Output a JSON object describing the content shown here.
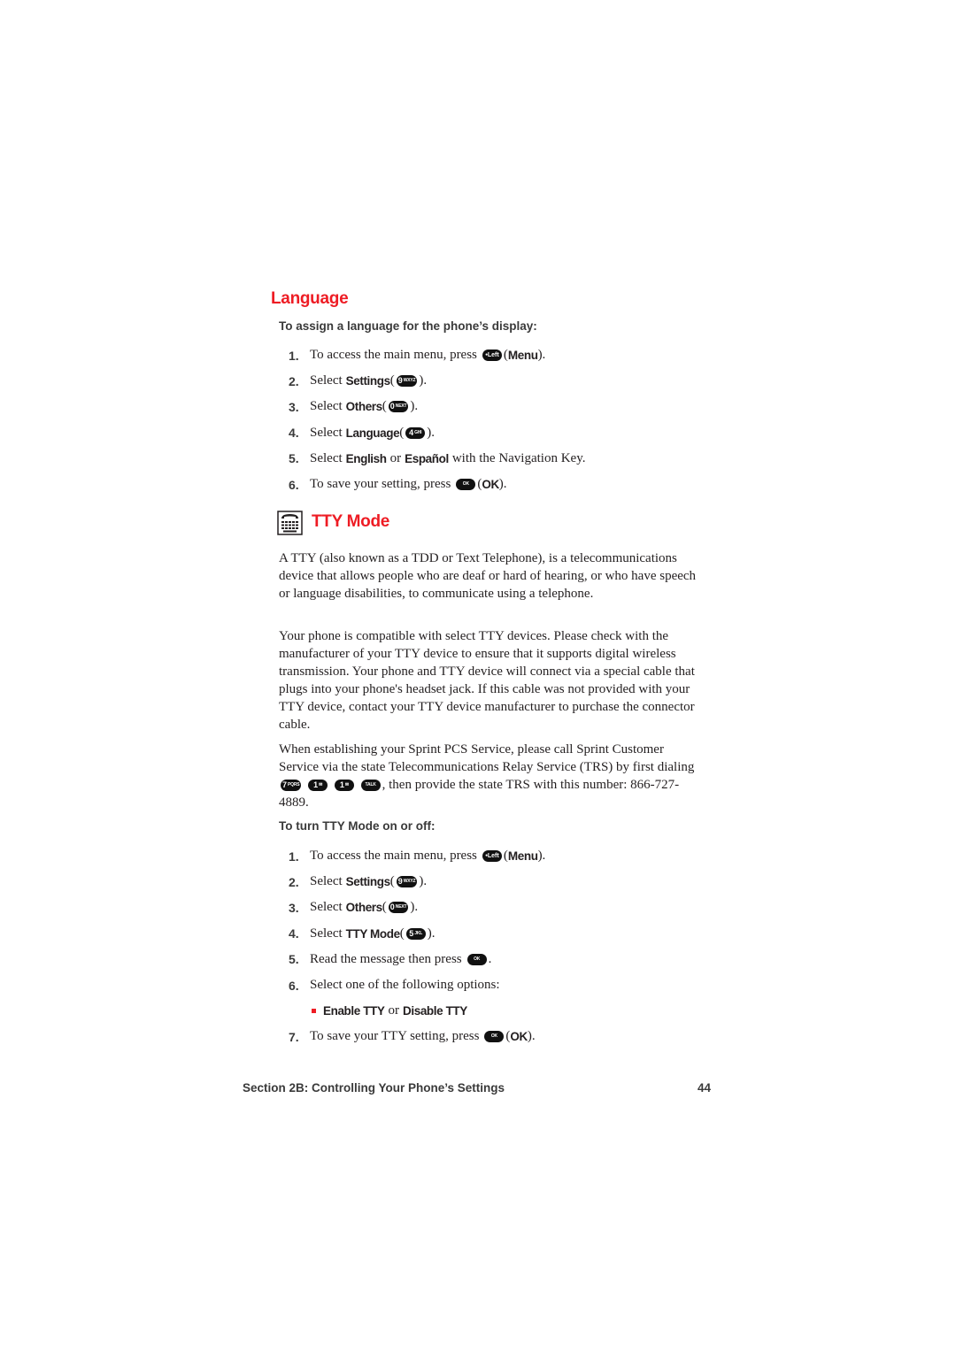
{
  "language_section": {
    "title": "Language",
    "subheading": "To assign a language for the phone’s display:",
    "steps": [
      {
        "num": "1.",
        "pre": "To access the main menu, press",
        "key": "Left",
        "key_icon": "left-softkey-icon",
        "post_open": " (",
        "bold": "Menu",
        "post": ")."
      },
      {
        "num": "2.",
        "pre": "Select",
        "bold": "Settings",
        "open": " (",
        "key_digit": "9",
        "key_letters": "WXYZ",
        "close": " )."
      },
      {
        "num": "3.",
        "pre": "Select",
        "bold": "Others",
        "open": " (",
        "key_digit": "0",
        "key_letters": "NEXT",
        "close": " )."
      },
      {
        "num": "4.",
        "pre": "Select",
        "bold": "Language",
        "open": " (",
        "key_digit": "4",
        "key_letters": "GHI",
        "close": " )."
      },
      {
        "num": "5.",
        "pre": "Select",
        "bold1": "English",
        "mid": "or",
        "bold2": "Español",
        "post": "with the Navigation Key."
      },
      {
        "num": "6.",
        "pre": "To save your setting, press",
        "key": "OK",
        "open": " (",
        "bold": "OK",
        "close": ")."
      }
    ]
  },
  "tty_section": {
    "title": "TTY Mode",
    "icon": "tty-icon",
    "paragraphs": [
      "A TTY (also known as a TDD or Text Telephone), is a telecommunications device that allows people who are deaf or hard of hearing, or who have speech or language disabilities, to communicate using a telephone.",
      "Your phone is compatible with select TTY devices. Please check with the manufacturer of your TTY device to ensure that it supports digital wireless transmission. Your phone and TTY device will connect via a special cable that plugs into your phone's headset jack. If this cable was not provided with your TTY device, contact your TTY device manufacturer to purchase the connector cable."
    ],
    "trs_paragraph": {
      "pre": "When establishing your Sprint PCS Service, please call Sprint Customer Service via the state Telecommunications Relay Service (TRS) by first dialing",
      "keys": [
        {
          "digit": "7",
          "letters": "PQRS"
        },
        {
          "digit": "1",
          "letters": "✉"
        },
        {
          "digit": "1",
          "letters": "✉"
        },
        {
          "digit": "",
          "letters": "TALK"
        }
      ],
      "post": ", then provide the state TRS with this number: 866-727-4889."
    },
    "subheading": "To turn TTY Mode on or off:",
    "steps": [
      {
        "num": "1.",
        "pre": "To access the main menu, press",
        "key": "Left",
        "open": " (",
        "bold": "Menu",
        "close": ")."
      },
      {
        "num": "2.",
        "pre": "Select",
        "bold": "Settings",
        "open": " (",
        "key_digit": "9",
        "key_letters": "WXYZ",
        "close": " )."
      },
      {
        "num": "3.",
        "pre": "Select",
        "bold": "Others",
        "open": " (",
        "key_digit": "0",
        "key_letters": "NEXT",
        "close": " )."
      },
      {
        "num": "4.",
        "pre": "Select",
        "bold": "TTY Mode",
        "open": " (",
        "key_digit": "5",
        "key_letters": "JKL",
        "close": " )."
      },
      {
        "num": "5.",
        "pre": "Read the message then press",
        "key": "OK",
        "close": "."
      },
      {
        "num": "6.",
        "pre": "Select one of the following options:"
      },
      {
        "num": "7.",
        "pre": "To save your TTY setting, press",
        "key": "OK",
        "open": " (",
        "bold": "OK",
        "close": ")."
      }
    ],
    "option": {
      "bold1": "Enable TTY",
      "mid": "or",
      "bold2": "Disable TTY"
    }
  },
  "footer": {
    "section": "Section 2B: Controlling Your Phone’s Settings",
    "page": "44"
  },
  "colors": {
    "heading": "#ee1c24",
    "text": "#231f20",
    "bullet": "#ee1c24"
  }
}
